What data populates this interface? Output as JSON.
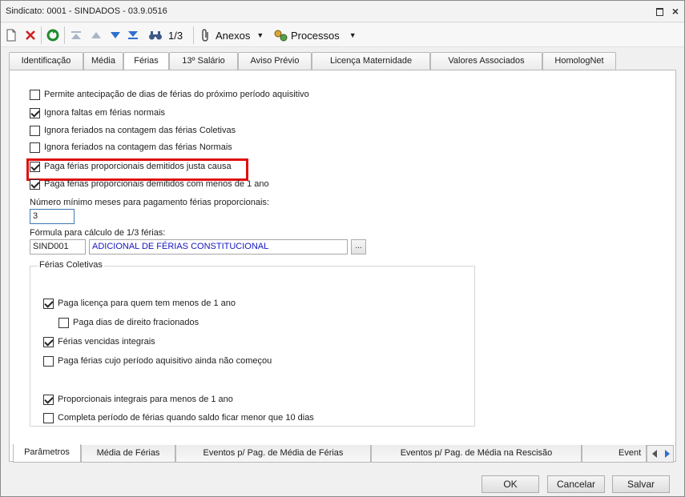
{
  "window": {
    "title": "Sindicato: 0001 - SINDADOS - 03.9.0516"
  },
  "toolbar": {
    "nav_count": "1/3",
    "attachments_label": "Anexos",
    "processes_label": "Processos"
  },
  "tabs_top": [
    "Identificação",
    "Média",
    "Férias",
    "13º Salário",
    "Aviso Prévio",
    "Licença Maternidade",
    "Valores Associados",
    "HomologNet"
  ],
  "active_top_tab": "Férias",
  "options": [
    {
      "label": "Permite antecipação de dias de férias do próximo período aquisitivo",
      "checked": false
    },
    {
      "label": "Ignora faltas em férias normais",
      "checked": true
    },
    {
      "label": "Ignora feriados na contagem das férias Coletivas",
      "checked": false
    },
    {
      "label": "Ignora feriados na contagem das férias Normais",
      "checked": false
    },
    {
      "label": "Paga férias proporcionais demitidos justa causa",
      "checked": true
    },
    {
      "label": "Paga férias proporcionais demitidos com menos de 1 ano",
      "checked": true
    }
  ],
  "min_months": {
    "label": "Número mínimo meses para pagamento férias proporcionais:",
    "value": "3"
  },
  "formula": {
    "label": "Fórmula para cálculo de 1/3 férias:",
    "code": "SIND001",
    "description": "ADICIONAL DE FÉRIAS CONSTITUCIONAL",
    "button": "..."
  },
  "group": {
    "title": "Férias Coletivas",
    "options": [
      {
        "label": "Paga licença para quem tem menos de 1 ano",
        "checked": true
      },
      {
        "label": "Paga dias de direito fracionados",
        "checked": false
      },
      {
        "label": "Férias vencidas integrais",
        "checked": true
      },
      {
        "label": "Paga férias cujo período aquisitivo ainda não começou",
        "checked": false
      },
      {
        "label": "Proporcionais integrais para menos de 1 ano",
        "checked": true
      },
      {
        "label": "Completa período de férias quando saldo ficar menor que 10 dias",
        "checked": false
      }
    ]
  },
  "tabs_bottom": [
    "Parâmetros",
    "Média de Férias",
    "Eventos p/ Pag. de Média de Férias",
    "Eventos p/ Pag. de Média na Rescisão",
    "Event"
  ],
  "active_bottom_tab": "Parâmetros",
  "footer": {
    "ok": "OK",
    "cancel": "Cancelar",
    "save": "Salvar"
  },
  "colors": {
    "highlight": "#e01010",
    "link_blue": "#1515c0",
    "accent": "#3d7ab3"
  }
}
